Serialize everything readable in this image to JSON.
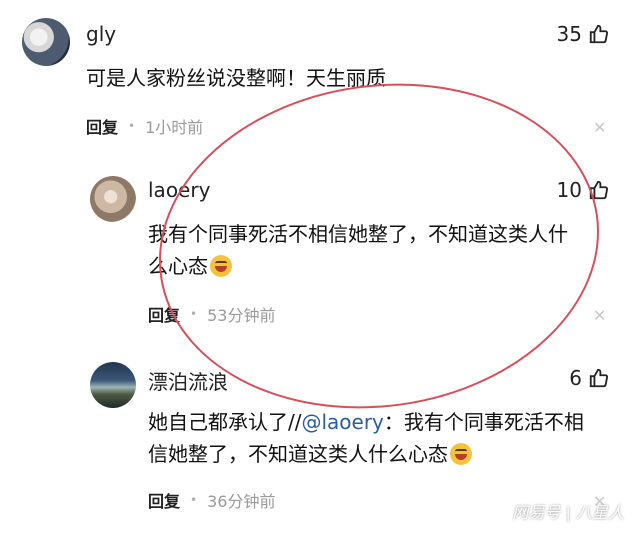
{
  "comments": [
    {
      "username": "gly",
      "likes": "35",
      "text": "可是人家粉丝说没整啊！天生丽质",
      "reply_label": "回复",
      "time": "1小时前"
    },
    {
      "username": "laoery",
      "likes": "10",
      "text_line1": "我有个同事死活不相信她整了，不知道这类人什",
      "text_line2": "么心态",
      "reply_label": "回复",
      "time": "53分钟前"
    },
    {
      "username": "漂泊流浪",
      "likes": "6",
      "text_prefix": "她自己都承认了//",
      "mention": "@laoery",
      "text_after_mention": "：我有个同事死活不相",
      "text_line2": "信她整了，不知道这类人什么心态",
      "reply_label": "回复",
      "time": "36分钟前"
    }
  ],
  "watermark": "网易号 | 八星人"
}
